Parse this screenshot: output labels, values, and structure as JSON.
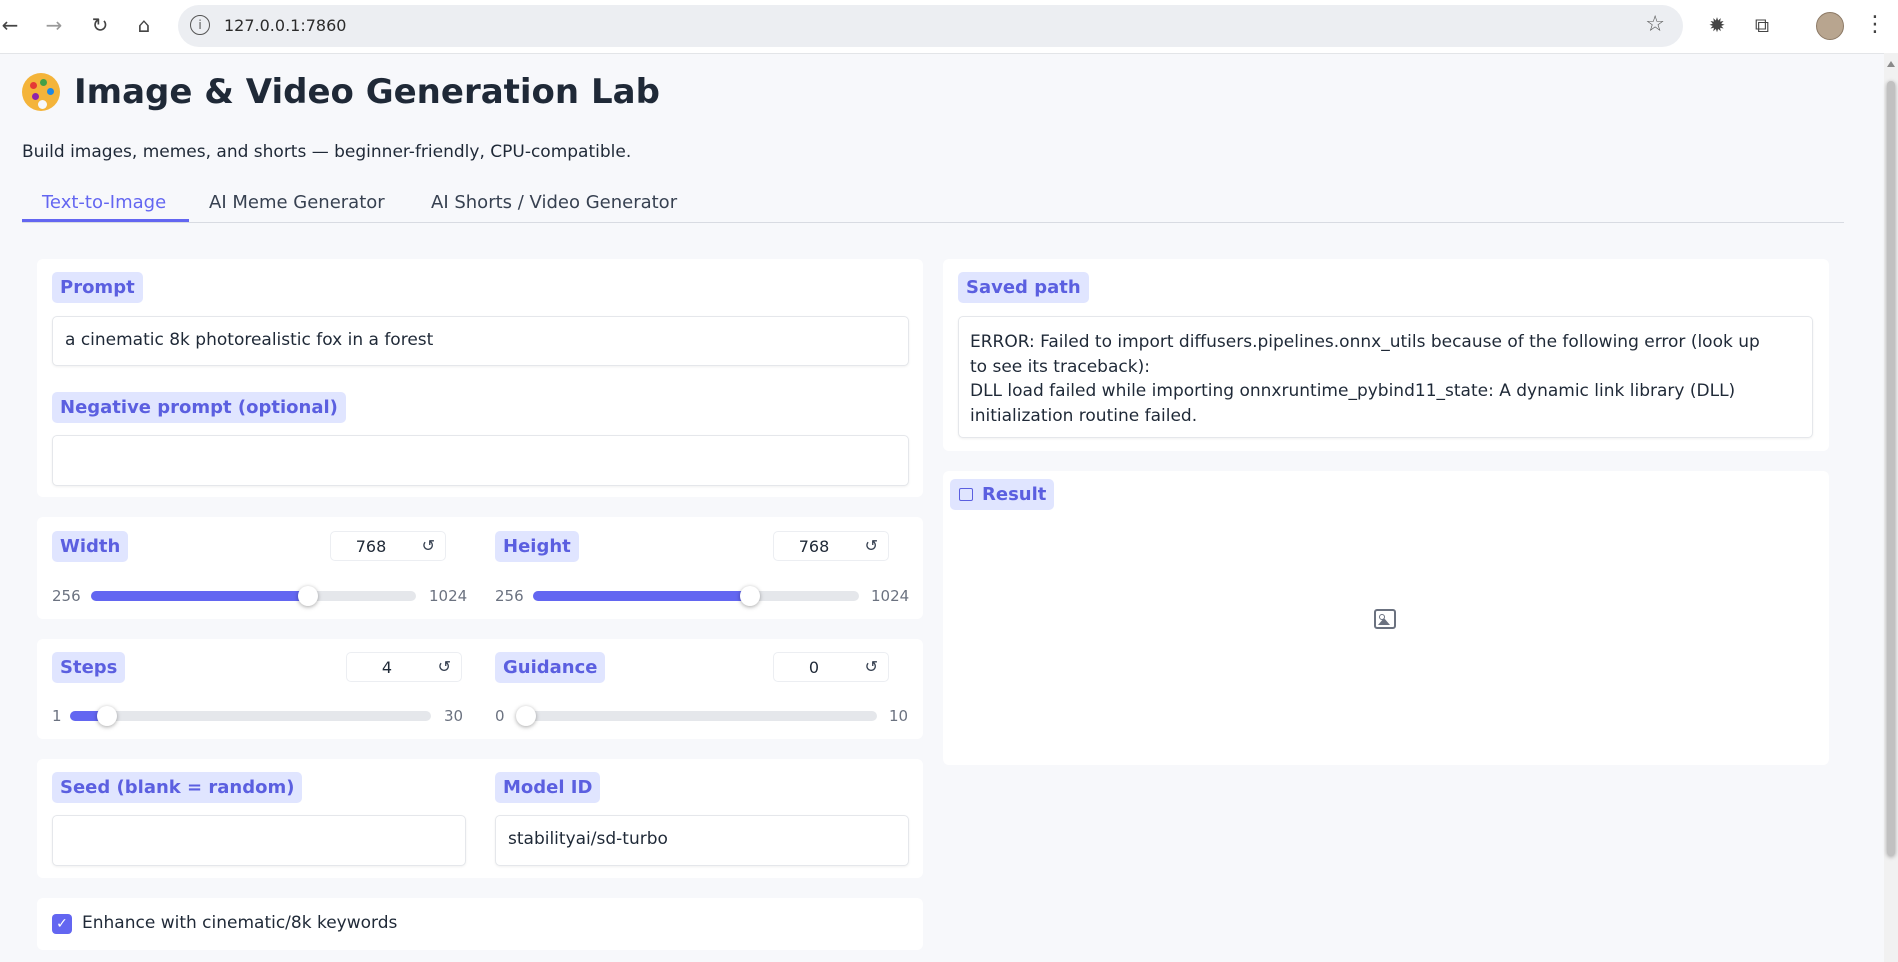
{
  "browser": {
    "url": "127.0.0.1:7860",
    "icons": [
      "back-icon",
      "forward-icon",
      "reload-icon",
      "home-icon",
      "site-info-icon",
      "bookmark-star-icon",
      "extension-puzzle-icon",
      "profile-avatar",
      "menu-dots-icon"
    ]
  },
  "app": {
    "title": "Image & Video Generation Lab",
    "subtitle": "Build images, memes, and shorts — beginner-friendly, CPU-compatible.",
    "accent_color": "#6366f1",
    "chip_color": "#e0e5ff"
  },
  "tabs": [
    {
      "label": "Text-to-Image",
      "active": true
    },
    {
      "label": "AI Meme Generator",
      "active": false
    },
    {
      "label": "AI Shorts / Video Generator",
      "active": false
    }
  ],
  "prompt": {
    "label": "Prompt",
    "value": "a cinematic 8k photorealistic fox in a forest"
  },
  "negative_prompt": {
    "label": "Negative prompt (optional)",
    "value": ""
  },
  "width": {
    "label": "Width",
    "value": "768",
    "min": "256",
    "max": "1024",
    "fraction": 0.667
  },
  "height": {
    "label": "Height",
    "value": "768",
    "min": "256",
    "max": "1024",
    "fraction": 0.667
  },
  "steps": {
    "label": "Steps",
    "value": "4",
    "min": "1",
    "max": "30",
    "fraction": 0.103
  },
  "guidance": {
    "label": "Guidance",
    "value": "0",
    "min": "0",
    "max": "10",
    "fraction": 0.0
  },
  "seed": {
    "label": "Seed (blank = random)",
    "value": ""
  },
  "model_id": {
    "label": "Model ID",
    "value": "stabilityai/sd-turbo"
  },
  "enhance": {
    "label": "Enhance with cinematic/8k keywords",
    "checked": true
  },
  "saved_path": {
    "label": "Saved path",
    "lines": [
      "ERROR: Failed to import diffusers.pipelines.onnx_utils because of the following error (look up",
      "to see its traceback):",
      "DLL load failed while importing onnxruntime_pybind11_state: A dynamic link library (DLL)",
      "initialization routine failed."
    ]
  },
  "result": {
    "label": "Result",
    "icon": "image-placeholder-icon"
  },
  "reset_glyph": "↺"
}
